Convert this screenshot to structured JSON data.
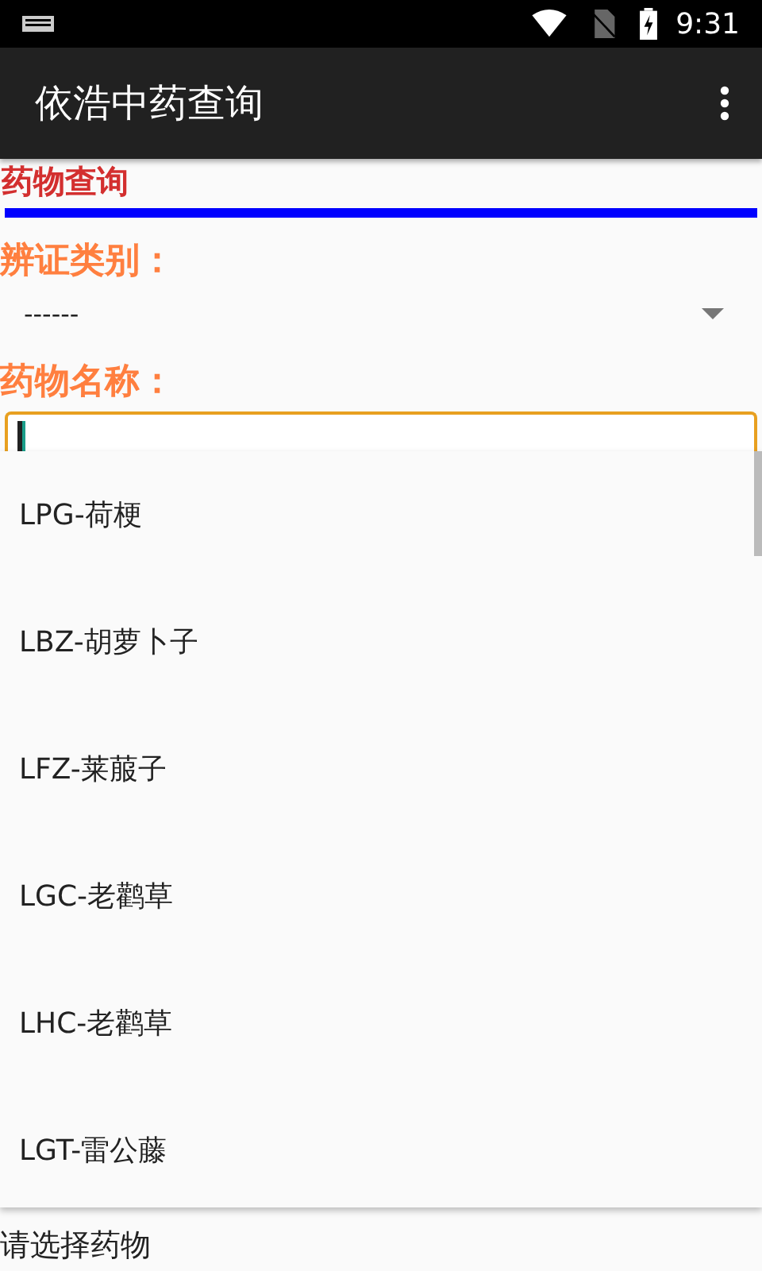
{
  "status_bar": {
    "time": "9:31"
  },
  "app_bar": {
    "title": "依浩中药查询"
  },
  "section_title": "药物查询",
  "category": {
    "label": "辨证类别：",
    "value": "------"
  },
  "drug_name": {
    "label": "药物名称："
  },
  "suggestions": [
    {
      "text": "LPG-荷梗"
    },
    {
      "text": "LBZ-胡萝卜子"
    },
    {
      "text": "LFZ-莱菔子"
    },
    {
      "text": "LGC-老鹳草"
    },
    {
      "text": "LHC-老鹳草"
    },
    {
      "text": "LGT-雷公藤"
    }
  ],
  "hint": "请选择药物"
}
